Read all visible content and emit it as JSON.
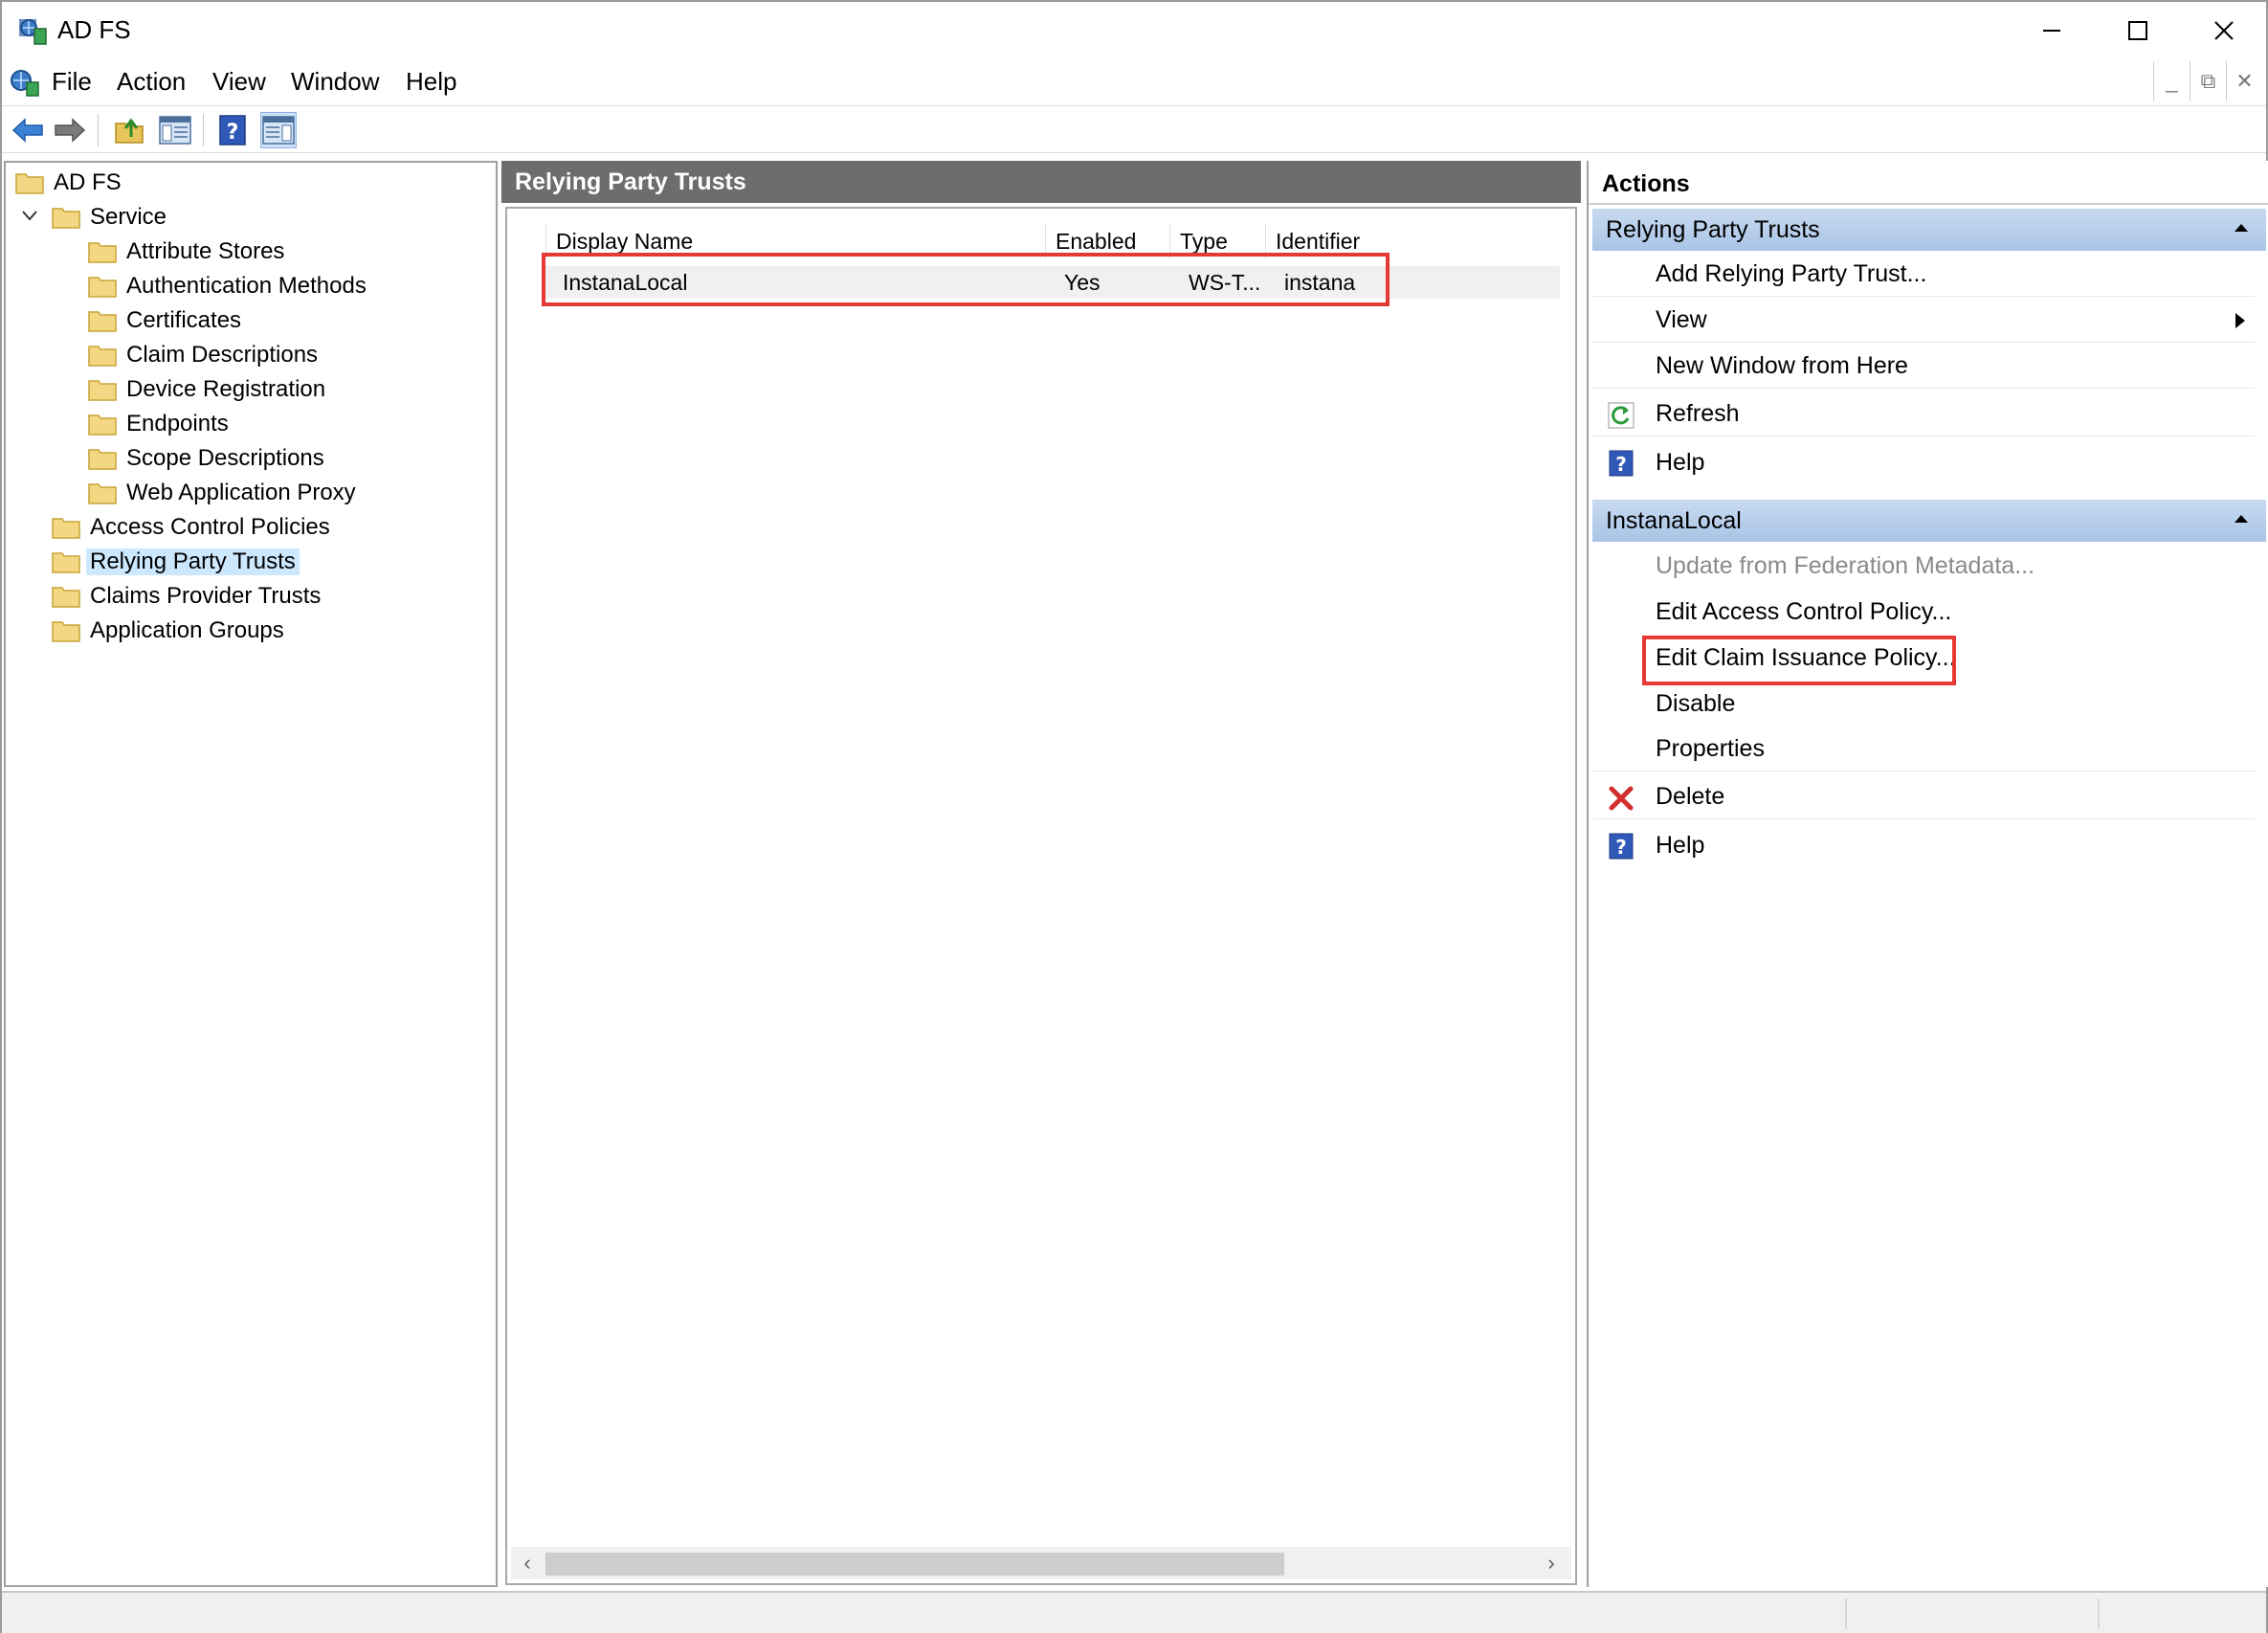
{
  "window": {
    "title": "AD FS"
  },
  "menu": {
    "items": [
      "File",
      "Action",
      "View",
      "Window",
      "Help"
    ]
  },
  "toolbar": {
    "buttons": [
      "back-icon",
      "forward-icon",
      "up-folder-icon",
      "show-hide-tree-icon",
      "help-icon",
      "show-hide-action-pane-icon"
    ]
  },
  "tree": {
    "root": "AD FS",
    "service": "Service",
    "service_children": [
      "Attribute Stores",
      "Authentication Methods",
      "Certificates",
      "Claim Descriptions",
      "Device Registration",
      "Endpoints",
      "Scope Descriptions",
      "Web Application Proxy"
    ],
    "top_items": [
      "Access Control Policies",
      "Relying Party Trusts",
      "Claims Provider Trusts",
      "Application Groups"
    ],
    "selected": "Relying Party Trusts"
  },
  "center": {
    "header": "Relying Party Trusts",
    "columns": [
      "Display Name",
      "Enabled",
      "Type",
      "Identifier"
    ],
    "rows": [
      {
        "display_name": "InstanaLocal",
        "enabled": "Yes",
        "type": "WS-T...",
        "identifier": "instana"
      }
    ]
  },
  "actions": {
    "title": "Actions",
    "sections": [
      {
        "header": "Relying Party Trusts",
        "items": [
          {
            "label": "Add Relying Party Trust...",
            "icon": ""
          },
          {
            "label": "View",
            "icon": "",
            "submenu": true
          },
          {
            "label": "New Window from Here",
            "icon": ""
          },
          {
            "label": "Refresh",
            "icon": "refresh-icon"
          },
          {
            "label": "Help",
            "icon": "help-icon"
          }
        ]
      },
      {
        "header": "InstanaLocal",
        "items": [
          {
            "label": "Update from Federation Metadata...",
            "icon": "",
            "disabled": true
          },
          {
            "label": "Edit Access Control Policy...",
            "icon": ""
          },
          {
            "label": "Edit Claim Issuance Policy...",
            "icon": "",
            "highlighted": true
          },
          {
            "label": "Disable",
            "icon": ""
          },
          {
            "label": "Properties",
            "icon": ""
          },
          {
            "label": "Delete",
            "icon": "delete-icon"
          },
          {
            "label": "Help",
            "icon": "help-icon"
          }
        ]
      }
    ]
  },
  "colors": {
    "highlight_box": "#e53935",
    "selection": "#cce8ff",
    "pane_header": "#6d6d6d",
    "section_header": "#b8cfeb"
  }
}
